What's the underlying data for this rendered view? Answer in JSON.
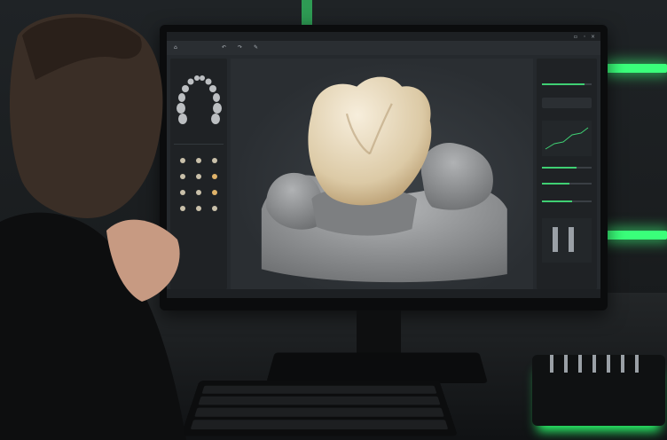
{
  "app": {
    "title_text": "",
    "right_panel_header": "",
    "left_panel_header": ""
  },
  "colors": {
    "accent_green": "#3fcf73",
    "shelf_glow": "#3aff7a",
    "screen_bg": "#25292d",
    "crown": "#e8dcc4",
    "gum_model": "#8c8e90"
  },
  "icons": [
    "window-minimize-icon",
    "window-maximize-icon",
    "window-close-icon",
    "undo-icon",
    "redo-icon",
    "tooth-icon"
  ],
  "sliders": [
    {
      "level": 0.85
    },
    {
      "level": 0.7
    },
    {
      "level": 0.55
    },
    {
      "level": 0.6
    }
  ]
}
